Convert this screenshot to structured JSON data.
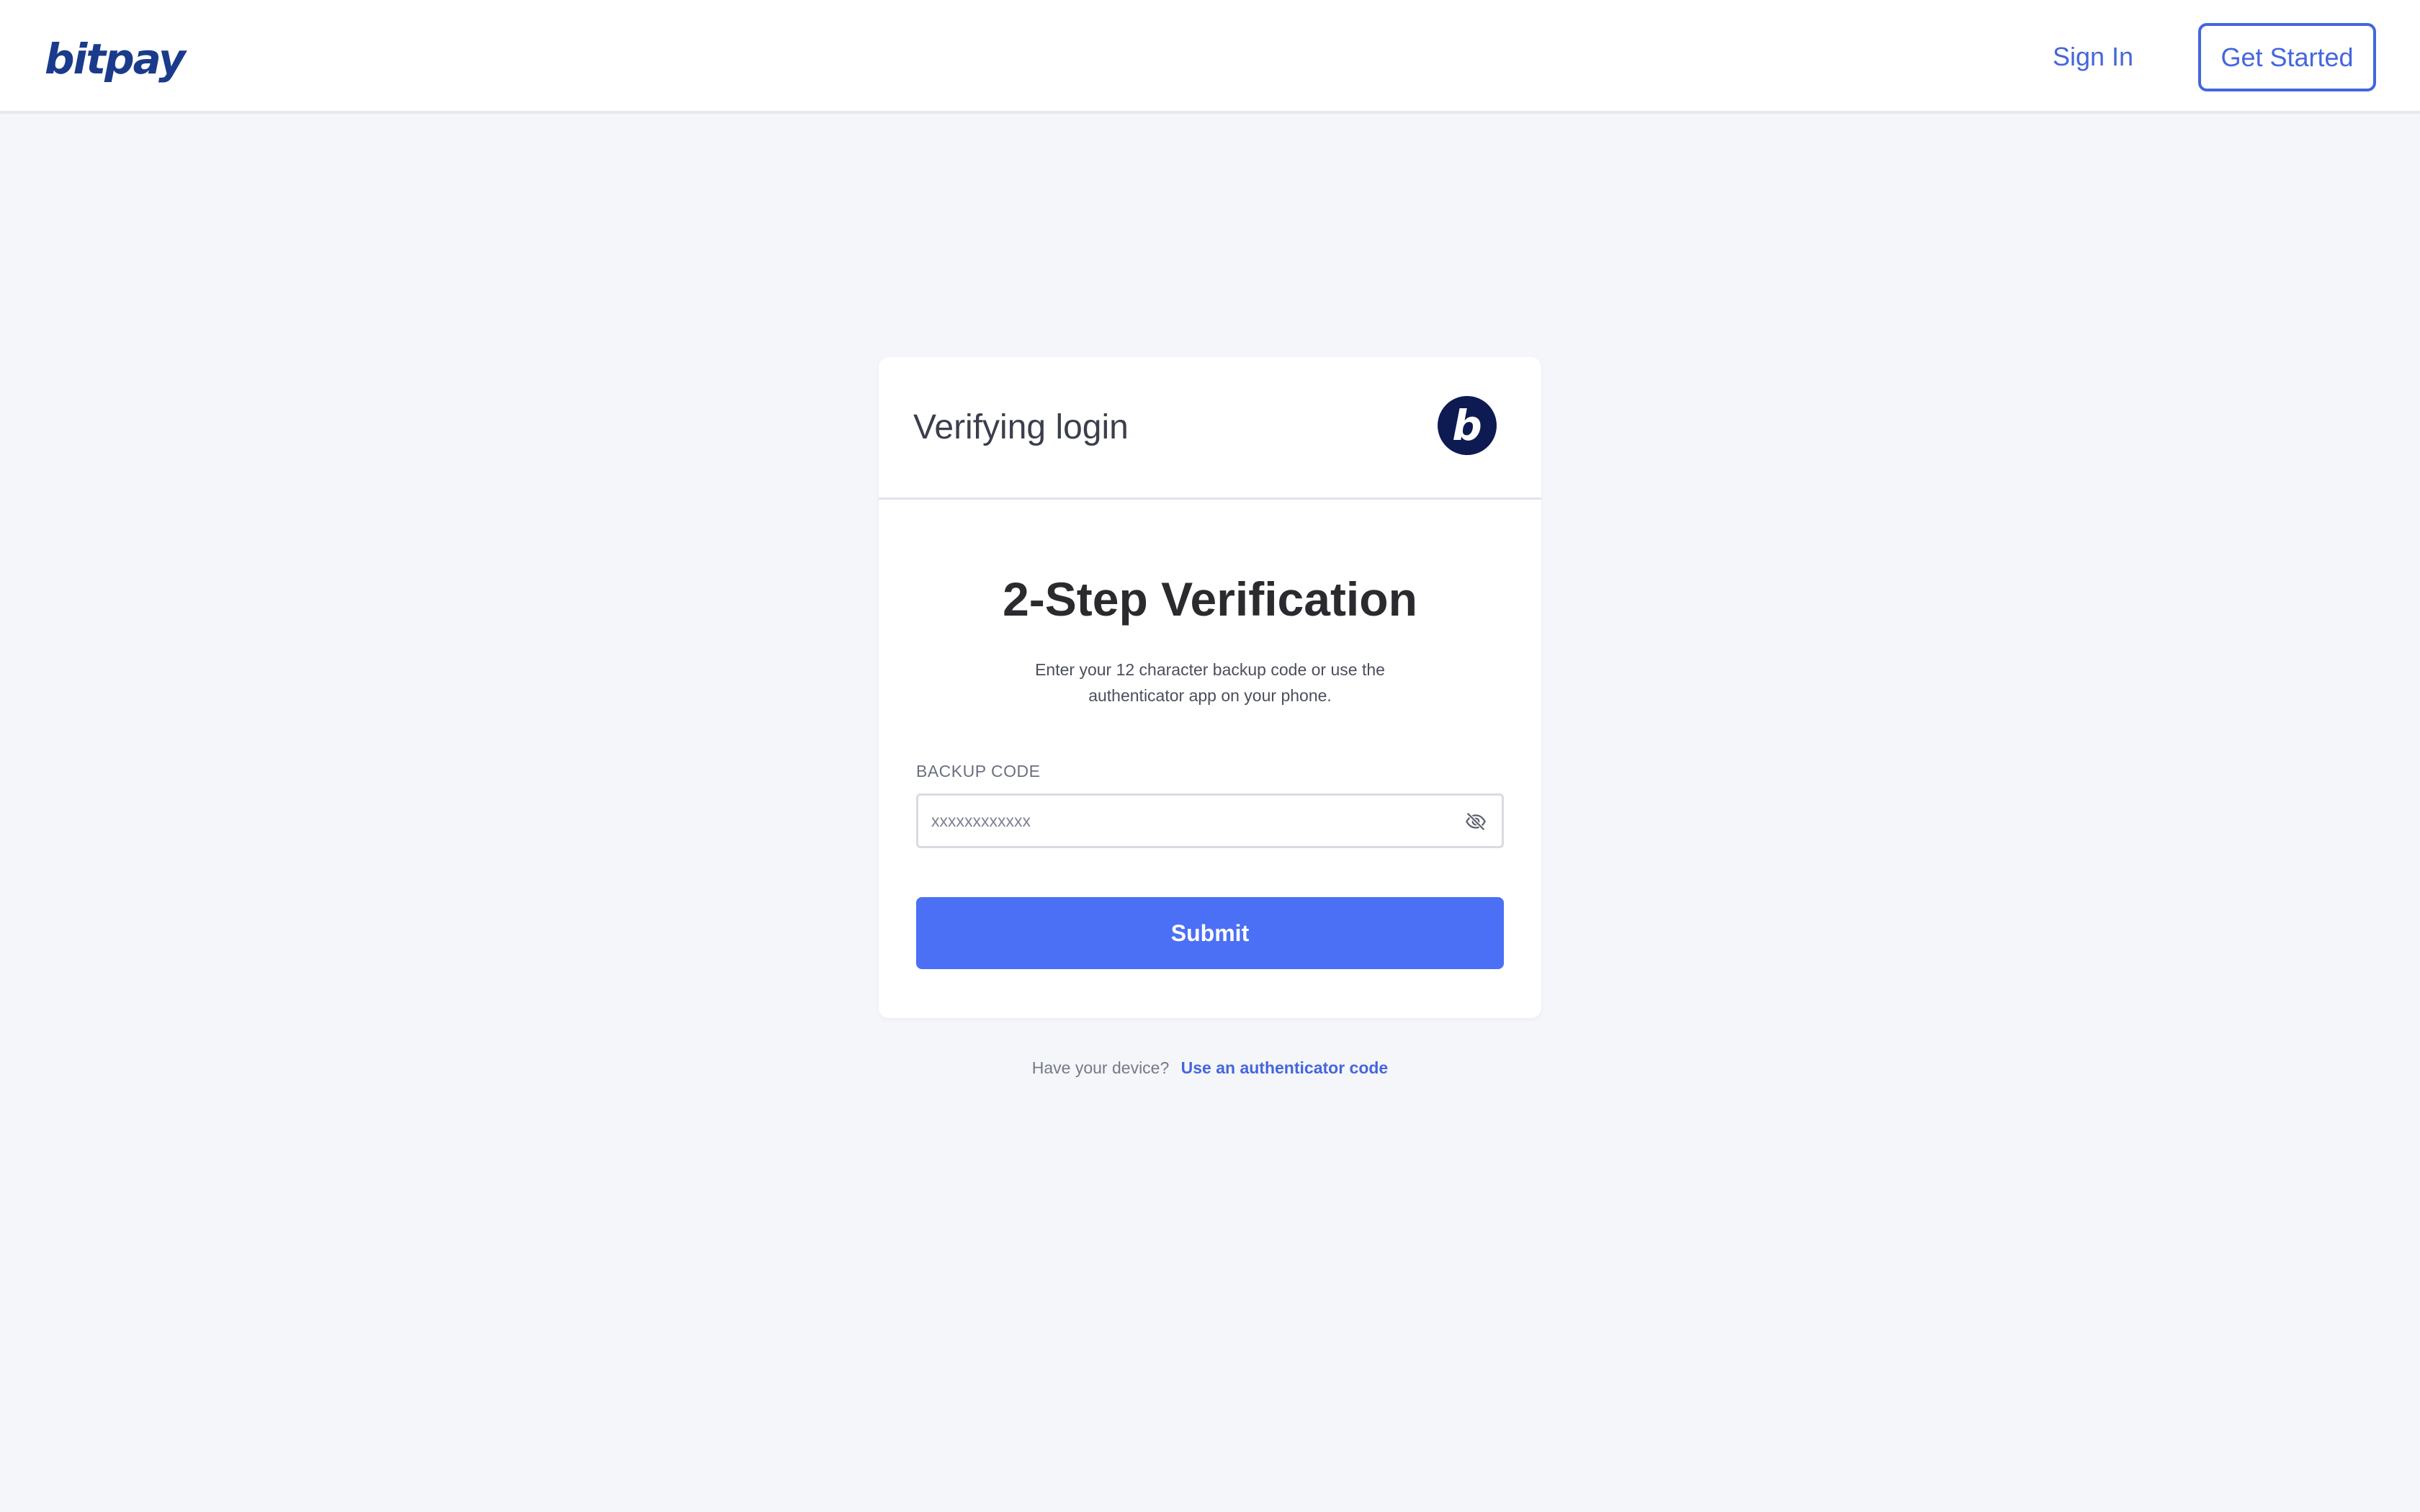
{
  "header": {
    "logo_text": "bitpay",
    "sign_in_label": "Sign In",
    "get_started_label": "Get Started"
  },
  "card": {
    "title": "Verifying login",
    "badge_letter": "b",
    "heading": "2-Step Verification",
    "description": "Enter your 12 character backup code or use the authenticator app on your phone.",
    "field_label": "BACKUP CODE",
    "field_placeholder": "xxxxxxxxxxxx",
    "field_value": "",
    "visibility_icon": "eye-off-icon",
    "submit_label": "Submit"
  },
  "footer": {
    "prompt_text": "Have your device?",
    "link_text": "Use an authenticator code"
  },
  "colors": {
    "brand_dark": "#1a3b8b",
    "accent": "#4466dd",
    "button": "#4b6ff5",
    "badge_bg": "#0e1a52",
    "page_bg": "#f5f6fa"
  }
}
